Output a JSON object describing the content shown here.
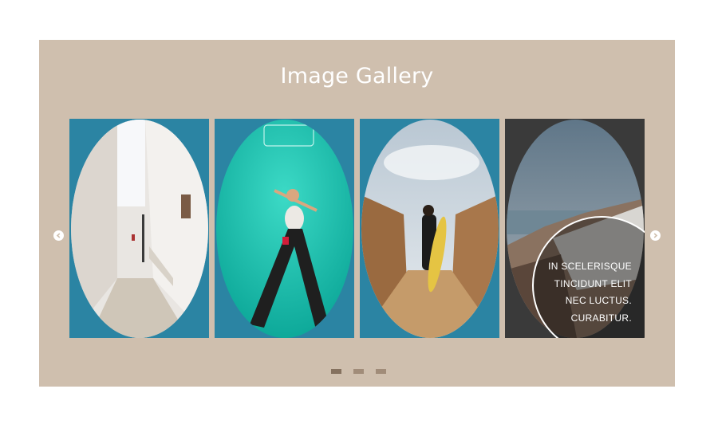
{
  "gallery": {
    "title": "Image Gallery",
    "overlay_caption": "IN SCELERISQUE TINCIDUNT ELIT NEC LUCTUS. CURABITUR.",
    "overlay_lines": [
      "IN SCELERISQUE",
      "TINCIDUNT ELIT",
      "NEC LUCTUS.",
      "CURABITUR."
    ],
    "slides": [
      {
        "name": "white-alley-photo"
      },
      {
        "name": "neon-sign-woman-photo"
      },
      {
        "name": "surfer-boardwalk-photo"
      },
      {
        "name": "santorini-cliffs-photo"
      }
    ],
    "prev_icon": "chevron-left-icon",
    "next_icon": "chevron-right-icon",
    "pagination": {
      "count": 3,
      "active_index": 0
    }
  },
  "colors": {
    "panel_background": "#cfbfae",
    "card_background": "#2b84a3",
    "dot_active": "#85715f",
    "dot_inactive": "#a18c79"
  }
}
